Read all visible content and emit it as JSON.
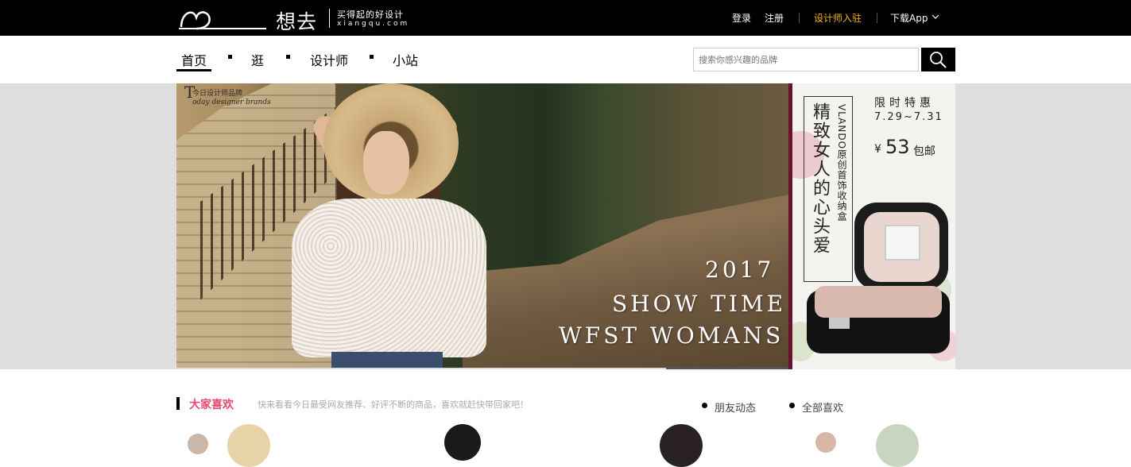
{
  "header": {
    "logo_text": "想去",
    "logo_slogan": "买得起的好设计",
    "logo_domain": "xiangqu.com",
    "login": "登录",
    "register": "注册",
    "designer_join": "设计师入驻",
    "download_app": "下载App",
    "accent_color": "#f5b500"
  },
  "nav": {
    "items": [
      "首页",
      "逛",
      "设计师",
      "小站"
    ],
    "active_index": 0
  },
  "search": {
    "placeholder": "搜索你感兴趣的品牌",
    "button_icon": "search-icon"
  },
  "banner": {
    "tag_line1": "今日设计师品牌",
    "tag_line2": "oday designer brands",
    "tag_letter": "T",
    "title_year": "2017",
    "title_line2": "SHOW TIME",
    "title_line3": "WFST WOMANS"
  },
  "side_banner": {
    "vertical_title": "精致女人的心头爱",
    "vertical_brand": "VLANDO原创首饰收纳盒",
    "promo_title": "限时特惠",
    "promo_dates": "7.29~7.31",
    "price_currency": "¥",
    "price_value": "53",
    "price_suffix": "包邮"
  },
  "section": {
    "title": "大家喜欢",
    "description": "快来看看今日最受网友推荐、好评不断的商品，喜欢就赶快带回家吧！",
    "tabs": [
      "朋友动态",
      "全部喜欢"
    ],
    "title_color": "#e8476e"
  }
}
